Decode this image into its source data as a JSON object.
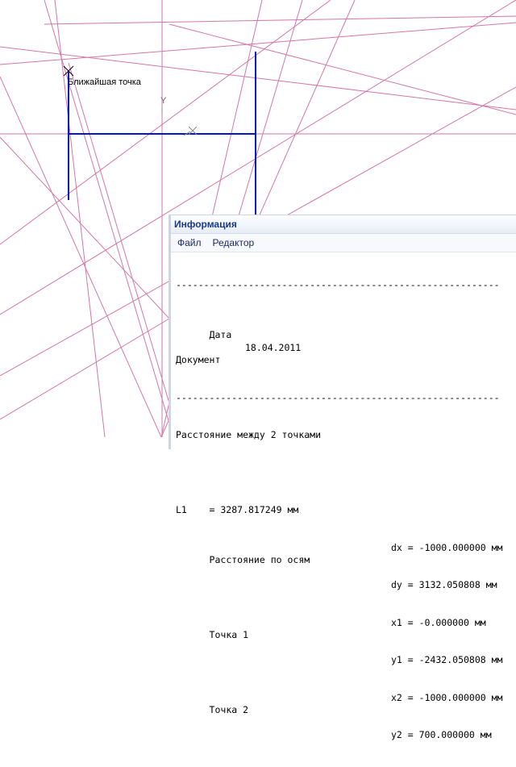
{
  "canvas": {
    "snap_label": "Ближайшая точка",
    "y_axis_label": "Y",
    "construction_color": "#d277a8",
    "geometry_color": "#0018c8"
  },
  "info_window": {
    "title": "Информация",
    "menu": [
      "Файл",
      "Редактор"
    ],
    "separator": "----------------------------------------------------------",
    "date_label": "Дата",
    "date_value": "18.04.2011",
    "document_label": "Документ",
    "heading": "Расстояние между 2 точками",
    "l1": "L1    = 3287.817249 мм",
    "axis_label": "Расстояние по осям",
    "dx": "dx = -1000.000000 мм",
    "dy": "dy = 3132.050808 мм",
    "point1_label": "Точка 1",
    "x1": "x1 = -0.000000 мм",
    "y1": "y1 = -2432.050808 мм",
    "point2_label": "Точка 2",
    "x2": "x2 = -1000.000000 мм",
    "y2": "y2 = 700.000000 мм"
  }
}
